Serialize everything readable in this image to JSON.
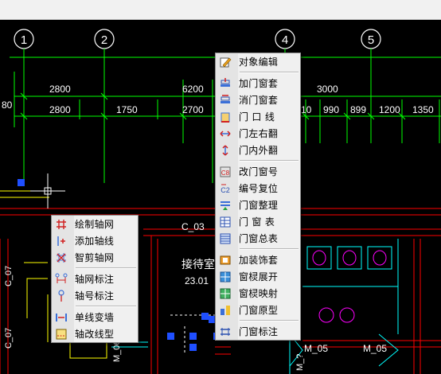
{
  "colors": {
    "background": "#000000",
    "axis": "#00ff00",
    "wall_red": "#ff0000",
    "cyan": "#00ffff",
    "magenta": "#ff00ff",
    "yellow": "#ffff00",
    "white": "#ffffff",
    "menu_bg": "#f0f0f0"
  },
  "drawing": {
    "axis_labels": [
      "1",
      "2",
      "4",
      "5"
    ],
    "dim_top_row": [
      "2800",
      "6200",
      "3000"
    ],
    "dim_second_row": [
      "2800",
      "1750",
      "2700",
      "10",
      "990",
      "899",
      "1200",
      "1350"
    ],
    "left_dim": "80",
    "room_name": "接待室",
    "room_area": "23.01",
    "labels": {
      "c03": "C_03",
      "c07_a": "C_07",
      "c07_b": "C_07",
      "m06": "M_06",
      "m05_a": "M_05",
      "m05_b": "M_05",
      "bottom_text": "M_?"
    }
  },
  "context_menu_main": {
    "items": [
      {
        "label": "对象编辑",
        "icon": "object-edit-icon"
      },
      {
        "sep": true
      },
      {
        "label": "加门窗套",
        "icon": "add-frame-icon"
      },
      {
        "label": "消门窗套",
        "icon": "remove-frame-icon"
      },
      {
        "label": "门 口 线",
        "icon": "door-line-icon"
      },
      {
        "label": "门左右翻",
        "icon": "flip-lr-icon"
      },
      {
        "label": "门内外翻",
        "icon": "flip-io-icon"
      },
      {
        "sep": true
      },
      {
        "label": "改门窗号",
        "icon": "rename-icon"
      },
      {
        "label": "编号复位",
        "icon": "reset-number-icon"
      },
      {
        "label": "门窗整理",
        "icon": "organize-icon"
      },
      {
        "label": "门 窗 表",
        "icon": "table-icon"
      },
      {
        "label": "门窗总表",
        "icon": "summary-table-icon"
      },
      {
        "sep": true
      },
      {
        "label": "加装饰套",
        "icon": "decor-frame-icon"
      },
      {
        "label": "窗棂展开",
        "icon": "lattice-expand-icon"
      },
      {
        "label": "窗棂映射",
        "icon": "lattice-map-icon"
      },
      {
        "label": "门窗原型",
        "icon": "prototype-icon"
      },
      {
        "sep": true
      },
      {
        "label": "门窗标注",
        "icon": "annotate-icon"
      }
    ]
  },
  "context_menu_axis": {
    "items": [
      {
        "label": "绘制轴网",
        "icon": "draw-grid-icon"
      },
      {
        "label": "添加轴线",
        "icon": "add-axis-icon"
      },
      {
        "label": "智剪轴网",
        "icon": "trim-grid-icon"
      },
      {
        "sep": true
      },
      {
        "label": "轴网标注",
        "icon": "grid-annotate-icon"
      },
      {
        "label": "轴号标注",
        "icon": "axis-number-icon"
      },
      {
        "sep": true
      },
      {
        "label": "单线变墙",
        "icon": "line-to-wall-icon"
      },
      {
        "label": "轴改线型",
        "icon": "axis-linetype-icon"
      }
    ]
  }
}
